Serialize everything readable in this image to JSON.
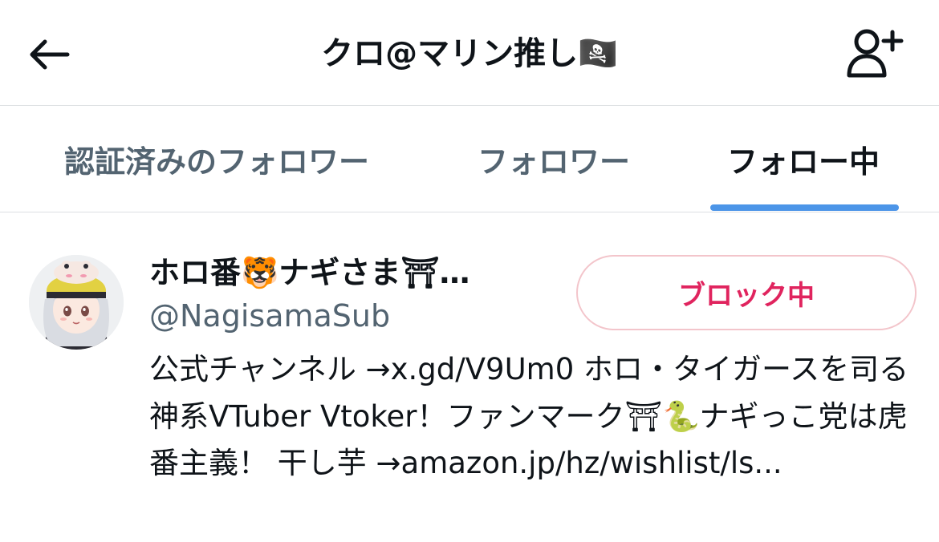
{
  "header": {
    "title": "クロ@マリン推し🏴‍☠️",
    "back_icon": "arrow-left-icon",
    "add_user_icon": "person-add-icon"
  },
  "tabs": [
    {
      "label": "認証済みのフォロワー",
      "active": false
    },
    {
      "label": "フォロワー",
      "active": false
    },
    {
      "label": "フォロー中",
      "active": true
    }
  ],
  "accent_color": "#4c95e8",
  "user": {
    "display_name": "ホロ番🐯ナギさま⛩…",
    "handle": "@NagisamaSub",
    "button_label": "ブロック中",
    "button_color": "#e0245e",
    "bio": "公式チャンネル →x.gd/V9Um0 ホロ・タイガースを司る神系VTuber Vtoker！ファンマーク⛩🐍ナギっこ党は虎番主義！ 干し芋 →amazon.jp/hz/wishlist/ls..."
  }
}
